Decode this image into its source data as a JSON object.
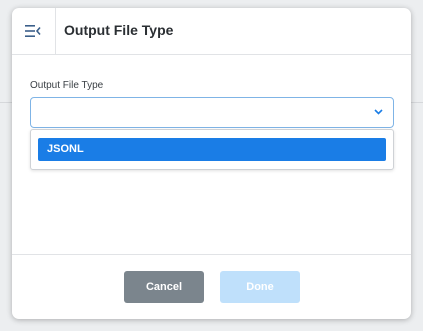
{
  "dialog": {
    "title": "Output File Type",
    "menu_icon": "collapse-menu-icon"
  },
  "field": {
    "label": "Output File Type",
    "value": "",
    "chevron_icon": "chevron-down-icon",
    "options": [
      "JSONL"
    ],
    "highlighted_option": "JSONL"
  },
  "footer": {
    "cancel_label": "Cancel",
    "done_label": "Done"
  },
  "colors": {
    "accent": "#1a7de6",
    "cancel_button": "#7b858d",
    "done_button_disabled": "#bfe0fb",
    "focus_border": "#7fb4e6"
  }
}
